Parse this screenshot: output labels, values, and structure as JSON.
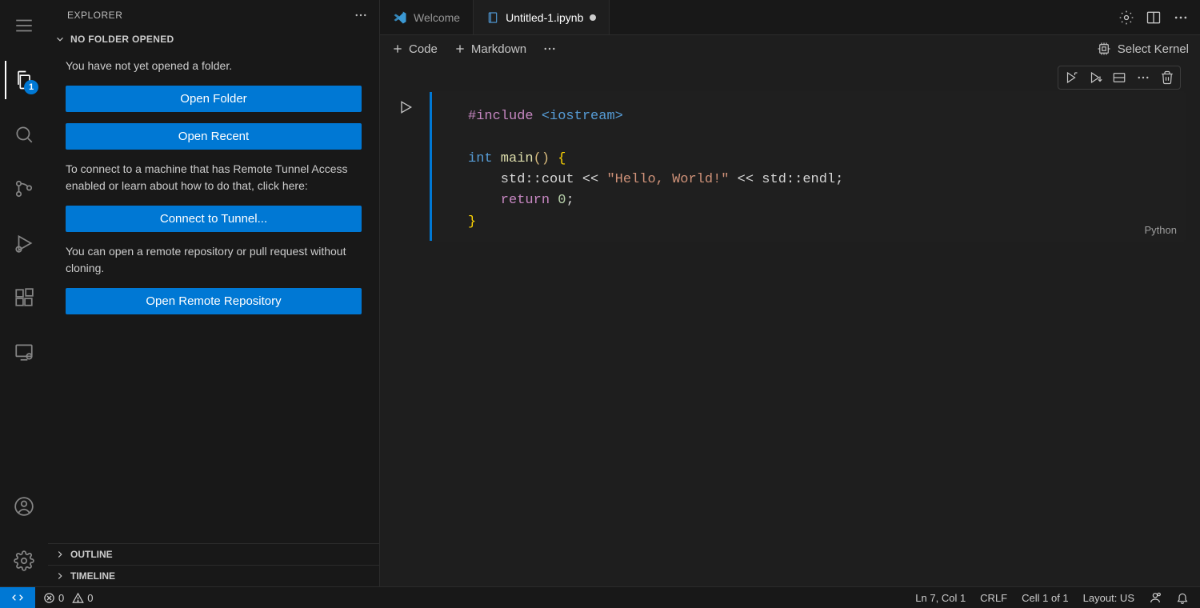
{
  "sidebar": {
    "title": "EXPLORER",
    "section_title": "NO FOLDER OPENED",
    "no_folder_text": "You have not yet opened a folder.",
    "open_folder_btn": "Open Folder",
    "open_recent_btn": "Open Recent",
    "tunnel_text": "To connect to a machine that has Remote Tunnel Access enabled or learn about how to do that, click here:",
    "connect_tunnel_btn": "Connect to Tunnel...",
    "remote_repo_text": "You can open a remote repository or pull request without cloning.",
    "open_remote_repo_btn": "Open Remote Repository",
    "outline_title": "OUTLINE",
    "timeline_title": "TIMELINE"
  },
  "activity": {
    "explorer_badge": "1"
  },
  "tabs": {
    "welcome": "Welcome",
    "notebook": "Untitled-1.ipynb"
  },
  "notebook": {
    "add_code": "Code",
    "add_markdown": "Markdown",
    "select_kernel": "Select Kernel",
    "cell_language": "Python"
  },
  "code": {
    "line1_pp": "#include",
    "line1_inc": " <iostream>",
    "line3_kw": "int",
    "line3_fn": " main",
    "line3_rest": "() ",
    "line3_brace": "{",
    "line4_a": "    std",
    "line4_op1": "::",
    "line4_b": "cout ",
    "line4_op2": "<< ",
    "line4_str": "\"Hello, World!\"",
    "line4_op3": " << ",
    "line4_c": "std",
    "line4_op4": "::",
    "line4_d": "endl",
    "line4_semi": ";",
    "line5_ret": "    return",
    "line5_num": " 0",
    "line5_semi": ";",
    "line6_brace": "}"
  },
  "status": {
    "errors": "0",
    "warnings": "0",
    "ln_col": "Ln 7, Col 1",
    "eol": "CRLF",
    "cell": "Cell 1 of 1",
    "layout": "Layout: US"
  }
}
